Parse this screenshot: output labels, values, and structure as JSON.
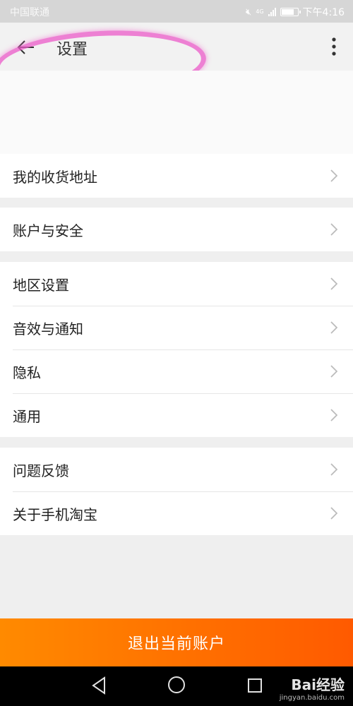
{
  "status_bar": {
    "carrier": "中国联通",
    "network": "4G",
    "time": "下午4:16",
    "battery_level": 0.85
  },
  "header": {
    "title": "设置",
    "back_icon": "back-arrow-icon",
    "more_icon": "more-vertical-icon"
  },
  "groups": [
    {
      "items": [
        {
          "label": "我的收货地址"
        }
      ]
    },
    {
      "items": [
        {
          "label": "账户与安全"
        }
      ]
    },
    {
      "items": [
        {
          "label": "地区设置"
        },
        {
          "label": "音效与通知"
        },
        {
          "label": "隐私"
        },
        {
          "label": "通用"
        }
      ]
    },
    {
      "items": [
        {
          "label": "问题反馈"
        },
        {
          "label": "关于手机淘宝"
        }
      ]
    }
  ],
  "logout": {
    "label": "退出当前账户"
  },
  "nav_bar": {
    "back_icon": "triangle-back-icon",
    "home_icon": "circle-home-icon",
    "recent_icon": "square-recent-icon"
  },
  "watermark": {
    "main": "Bai经验",
    "url": "jingyan.baidu.com"
  },
  "colors": {
    "accent": "#ff6a00",
    "background": "#efefef",
    "highlight": "#eb5ac8"
  }
}
